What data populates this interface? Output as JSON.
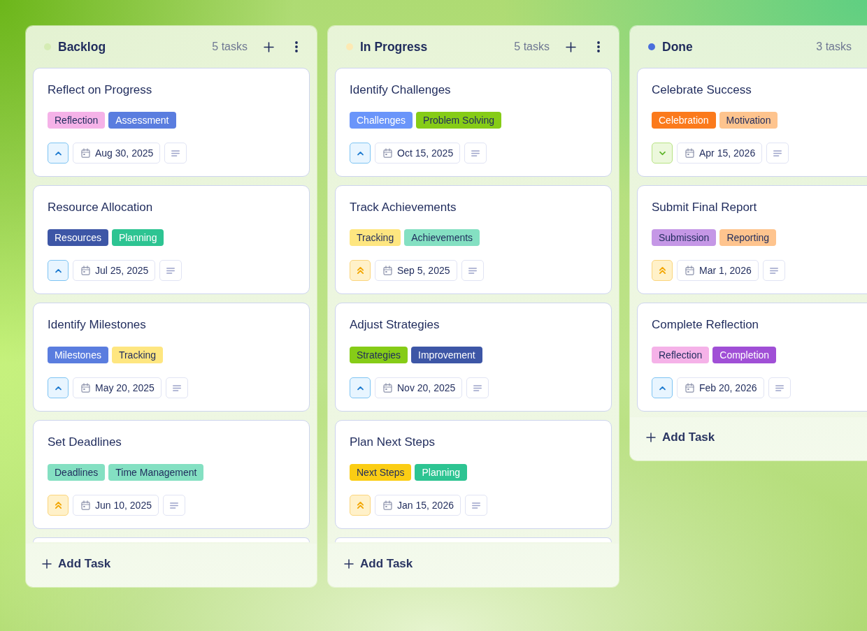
{
  "columns": [
    {
      "title": "Backlog",
      "color": "#d5ecb4",
      "count": "5 tasks",
      "header_actions": [
        {
          "kind": "add"
        },
        {
          "kind": "more"
        }
      ],
      "cards": [
        {
          "title": "Reflect on Progress",
          "tags": [
            {
              "label": "Reflection",
              "color": "#f5b2e8"
            },
            {
              "label": "Assessment",
              "color": "#5a7ddf"
            }
          ],
          "priority": {
            "kind": "medium"
          },
          "due": "Aug 30, 2025"
        },
        {
          "title": "Resource Allocation",
          "tags": [
            {
              "label": "Resources",
              "color": "#3d56a6"
            },
            {
              "label": "Planning",
              "color": "#2dc492"
            }
          ],
          "priority": {
            "kind": "medium"
          },
          "due": "Jul 25, 2025"
        },
        {
          "title": "Identify Milestones",
          "tags": [
            {
              "label": "Milestones",
              "color": "#5a7ddf"
            },
            {
              "label": "Tracking",
              "color": "#fee680"
            }
          ],
          "priority": {
            "kind": "medium"
          },
          "due": "May 20, 2025"
        },
        {
          "title": "Set Deadlines",
          "tags": [
            {
              "label": "Deadlines",
              "color": "#84e0c2"
            },
            {
              "label": "Time Management",
              "color": "#84e0c2"
            }
          ],
          "priority": {
            "kind": "high"
          },
          "due": "Jun 10, 2025"
        }
      ],
      "more_below": true,
      "add_task_label": "Add Task"
    },
    {
      "title": "In Progress",
      "color": "#fde9b3",
      "count": "5 tasks",
      "header_actions": [
        {
          "kind": "add"
        },
        {
          "kind": "more"
        }
      ],
      "cards": [
        {
          "title": "Identify Challenges",
          "tags": [
            {
              "label": "Challenges",
              "color": "#6a95fa"
            },
            {
              "label": "Problem Solving",
              "color": "#86cc17"
            }
          ],
          "priority": {
            "kind": "medium"
          },
          "due": "Oct 15, 2025"
        },
        {
          "title": "Track Achievements",
          "tags": [
            {
              "label": "Tracking",
              "color": "#fee680"
            },
            {
              "label": "Achievements",
              "color": "#84e0c2"
            }
          ],
          "priority": {
            "kind": "high"
          },
          "due": "Sep 5, 2025"
        },
        {
          "title": "Adjust Strategies",
          "tags": [
            {
              "label": "Strategies",
              "color": "#86cc17"
            },
            {
              "label": "Improvement",
              "color": "#3d56a6"
            }
          ],
          "priority": {
            "kind": "medium"
          },
          "due": "Nov 20, 2025"
        },
        {
          "title": "Plan Next Steps",
          "tags": [
            {
              "label": "Next Steps",
              "color": "#fbcd14"
            },
            {
              "label": "Planning",
              "color": "#2dc492"
            }
          ],
          "priority": {
            "kind": "high"
          },
          "due": "Jan 15, 2026"
        }
      ],
      "more_below": true,
      "add_task_label": "Add Task"
    },
    {
      "title": "Done",
      "color": "#4a6fdc",
      "count": "3 tasks",
      "cards": [
        {
          "title": "Celebrate Success",
          "tags": [
            {
              "label": "Celebration",
              "color": "#fb7a1c"
            },
            {
              "label": "Motivation",
              "color": "#fec48e"
            }
          ],
          "priority": {
            "kind": "low"
          },
          "due": "Apr 15, 2026"
        },
        {
          "title": "Submit Final Report",
          "tags": [
            {
              "label": "Submission",
              "color": "#c597e6"
            },
            {
              "label": "Reporting",
              "color": "#fec48e"
            }
          ],
          "priority": {
            "kind": "high"
          },
          "due": "Mar 1, 2026"
        },
        {
          "title": "Complete Reflection",
          "tags": [
            {
              "label": "Reflection",
              "color": "#f5b2e8"
            },
            {
              "label": "Completion",
              "color": "#a04fd6"
            }
          ],
          "priority": {
            "kind": "medium"
          },
          "due": "Feb 20, 2026"
        }
      ],
      "more_below": false,
      "add_task_label": "Add Task"
    }
  ]
}
